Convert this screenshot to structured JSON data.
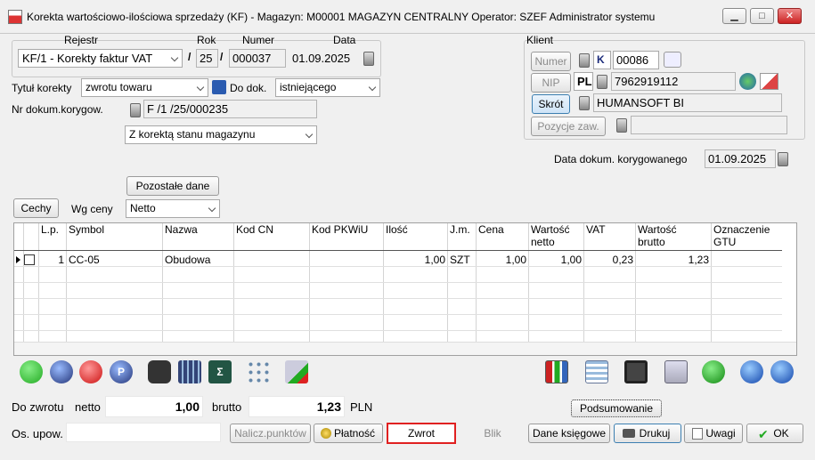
{
  "window": {
    "title": "Korekta wartościowo-ilościowa sprzedaży (KF) - Magazyn: M00001 MAGAZYN CENTRALNY  Operator: SZEF Administrator systemu",
    "min": "▁",
    "max": "□",
    "close": "✕"
  },
  "header": {
    "rejestr_label": "Rejestr",
    "rok_label": "Rok",
    "numer_label": "Numer",
    "data_label": "Data",
    "rejestr_value": "KF/1   - Korekty faktur VAT",
    "rok_value": "25",
    "numer_value": "000037",
    "data_value": "01.09.2025",
    "sep": "/",
    "tytul_label": "Tytuł korekty",
    "tytul_value": "zwrotu towaru",
    "dodok_label": "Do dok.",
    "dodok_value": "istniejącego",
    "nrdok_label": "Nr dokum.korygow.",
    "nrdok_value": "F /1  /25/000235",
    "stan_value": "Z korektą stanu magazynu",
    "datakor_label": "Data dokum. korygowanego",
    "datakor_value": "01.09.2025"
  },
  "klient": {
    "label": "Klient",
    "numer_btn": "Numer",
    "numer_type": "K",
    "numer_value": "00086",
    "nip_btn": "NIP",
    "nip_prefix": "PL",
    "nip_value": "7962919112",
    "skrot_btn": "Skrót",
    "skrot_value": "HUMANSOFT BI",
    "pozycje_btn": "Pozycje zaw.",
    "pozycje_value": ""
  },
  "controls": {
    "pozostale": "Pozostałe dane",
    "cechy": "Cechy",
    "wgceny_label": "Wg ceny",
    "wgceny_value": "Netto"
  },
  "table": {
    "columns": [
      "L.p.",
      "Symbol",
      "Nazwa",
      "Kod  CN",
      "Kod  PKWiU",
      "Ilość",
      "J.m.",
      "Cena",
      "Wartość netto",
      "VAT",
      "Wartość brutto",
      "Oznaczenie GTU"
    ],
    "rows": [
      {
        "lp": "1",
        "symbol": "CC-05",
        "nazwa": "Obudowa",
        "ilosc": "1,00",
        "jm": "SZT",
        "cena": "1,00",
        "netto": "1,00",
        "vat": "0,23",
        "brutto": "1,23"
      }
    ]
  },
  "toolbar": {
    "add": "add-icon",
    "properties": "properties-icon",
    "delete": "delete-icon",
    "p": "P",
    "search": "binoculars-icon",
    "calc": "calculator-icon",
    "sigma": "Σ",
    "icons": [
      "grid-icon",
      "refresh-icon",
      "chart-icon",
      "list-icon",
      "save-icon",
      "copy-icon",
      "recycle-icon",
      "first-icon",
      "last-icon"
    ]
  },
  "summary": {
    "dozwrotu_label": "Do zwrotu",
    "netto_label": "netto",
    "netto_value": "1,00",
    "brutto_label": "brutto",
    "brutto_value": "1,23",
    "currency": "PLN",
    "podsumowanie": "Podsumowanie",
    "osupow_label": "Os. upow.",
    "osupow_value": ""
  },
  "buttons": {
    "nalicz": "Nalicz.punktów",
    "platnosc": "Płatność",
    "zwrot": "Zwrot",
    "blik": "Blik",
    "dane": "Dane księgowe",
    "drukuj": "Drukuj",
    "uwagi": "Uwagi",
    "ok": "OK"
  }
}
